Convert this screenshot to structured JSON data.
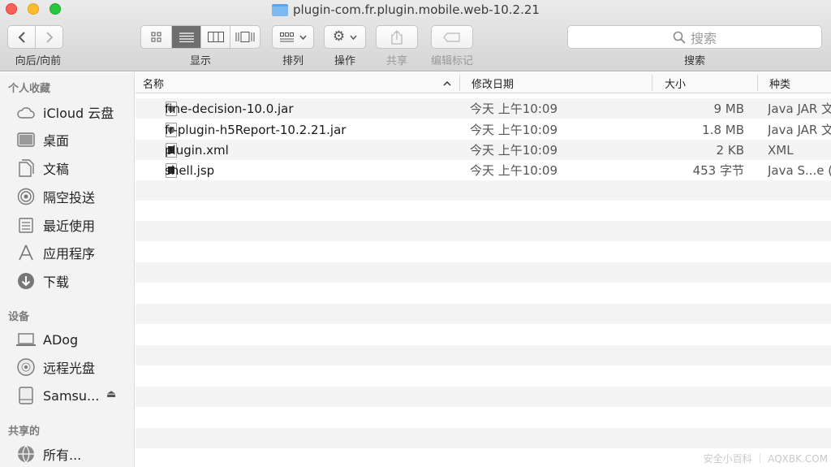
{
  "window": {
    "title": "plugin-com.fr.plugin.mobile.web-10.2.21"
  },
  "toolbar": {
    "nav_label": "向后/向前",
    "view_label": "显示",
    "arrange_label": "排列",
    "action_label": "操作",
    "share_label": "共享",
    "tags_label": "编辑标记",
    "search_label": "搜索",
    "search_placeholder": "搜索"
  },
  "sidebar": {
    "favorites_header": "个人收藏",
    "favorites": [
      {
        "label": "iCloud 云盘",
        "icon": "cloud-icon"
      },
      {
        "label": "桌面",
        "icon": "desktop-icon"
      },
      {
        "label": "文稿",
        "icon": "documents-icon"
      },
      {
        "label": "隔空投送",
        "icon": "airdrop-icon"
      },
      {
        "label": "最近使用",
        "icon": "recents-icon"
      },
      {
        "label": "应用程序",
        "icon": "applications-icon"
      },
      {
        "label": "下载",
        "icon": "downloads-icon"
      }
    ],
    "devices_header": "设备",
    "devices": [
      {
        "label": "ADog",
        "icon": "laptop-icon"
      },
      {
        "label": "远程光盘",
        "icon": "disc-icon"
      },
      {
        "label": "Samsu...",
        "icon": "drive-icon"
      }
    ],
    "shared_header": "共享的",
    "shared": [
      {
        "label": "所有...",
        "icon": "network-icon"
      }
    ]
  },
  "columns": {
    "name": "名称",
    "date": "修改日期",
    "size": "大小",
    "kind": "种类"
  },
  "files": [
    {
      "name": "fine-decision-10.0.jar",
      "date": "今天 上午10:09",
      "size": "9 MB",
      "kind": "Java JAR 文",
      "icon": "jar-file-icon"
    },
    {
      "name": "fr-plugin-h5Report-10.2.21.jar",
      "date": "今天 上午10:09",
      "size": "1.8 MB",
      "kind": "Java JAR 文",
      "icon": "jar-file-icon"
    },
    {
      "name": "plugin.xml",
      "date": "今天 上午10:09",
      "size": "2 KB",
      "kind": "XML",
      "icon": "xml-file-icon"
    },
    {
      "name": "shell.jsp",
      "date": "今天 上午10:09",
      "size": "453 字节",
      "kind": "Java S...e (",
      "icon": "jsp-file-icon"
    }
  ],
  "watermark": "安全小百科 ｜ AQXBK.COM"
}
